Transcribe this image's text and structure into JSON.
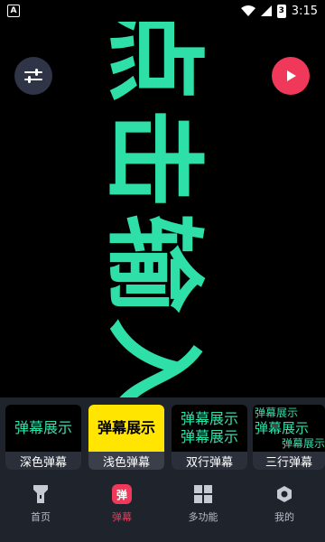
{
  "status_bar": {
    "app_badge": "A",
    "battery_level": "3",
    "time": "3:15"
  },
  "stage": {
    "danmaku_text": "点击输入",
    "text_color": "#2ee0a8",
    "background_color": "#000000"
  },
  "controls": {
    "settings_icon": "sliders-icon",
    "play_icon": "play-icon"
  },
  "style_cards": [
    {
      "preview_lines": [
        "弹幕展示"
      ],
      "caption": "深色弹幕"
    },
    {
      "preview_lines": [
        "弹幕展示"
      ],
      "caption": "浅色弹幕"
    },
    {
      "preview_lines": [
        "弹幕展示",
        "弹幕展示"
      ],
      "caption": "双行弹幕"
    },
    {
      "preview_lines": [
        "弹幕展示",
        "弹幕展示",
        "弹幕展示"
      ],
      "caption": "三行弹幕"
    }
  ],
  "nav": [
    {
      "label": "首页",
      "icon": "flashlight-icon"
    },
    {
      "label": "弹幕",
      "icon": "danmaku-icon",
      "icon_text": "弹",
      "active": true
    },
    {
      "label": "多功能",
      "icon": "grid-icon"
    },
    {
      "label": "我的",
      "icon": "gear-icon"
    }
  ],
  "colors": {
    "accent": "#f0395a",
    "danmaku_green": "#2ee0a8",
    "light_card": "#ffe500",
    "panel_bg": "#1f232c"
  }
}
